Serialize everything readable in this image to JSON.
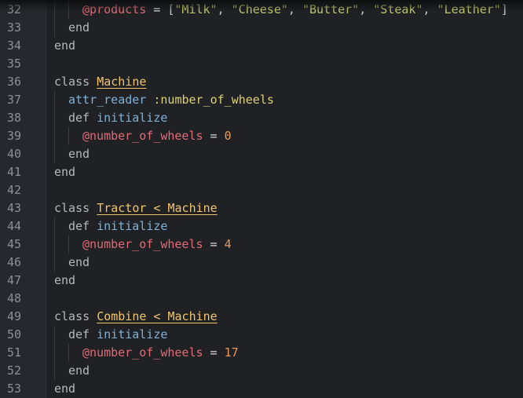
{
  "lines": [
    {
      "n": "32",
      "indent": 2,
      "tokens": [
        {
          "c": "ivar",
          "t": "@products"
        },
        {
          "c": "op",
          "t": " = "
        },
        {
          "c": "punc",
          "t": "["
        },
        {
          "c": "str",
          "t": "\"Milk\""
        },
        {
          "c": "punc",
          "t": ", "
        },
        {
          "c": "str",
          "t": "\"Cheese\""
        },
        {
          "c": "punc",
          "t": ", "
        },
        {
          "c": "str",
          "t": "\"Butter\""
        },
        {
          "c": "punc",
          "t": ", "
        },
        {
          "c": "str",
          "t": "\"Steak\""
        },
        {
          "c": "punc",
          "t": ", "
        },
        {
          "c": "str",
          "t": "\"Leather\""
        },
        {
          "c": "punc",
          "t": "]"
        }
      ]
    },
    {
      "n": "33",
      "indent": 1,
      "tokens": [
        {
          "c": "kw",
          "t": "end"
        }
      ]
    },
    {
      "n": "34",
      "indent": 0,
      "tokens": [
        {
          "c": "kw",
          "t": "end"
        }
      ]
    },
    {
      "n": "35",
      "indent": 0,
      "tokens": []
    },
    {
      "n": "36",
      "indent": 0,
      "tokens": [
        {
          "c": "kw",
          "t": "class "
        },
        {
          "c": "cls",
          "t": "Machine"
        }
      ]
    },
    {
      "n": "37",
      "indent": 1,
      "tokens": [
        {
          "c": "meth",
          "t": "attr_reader "
        },
        {
          "c": "sym",
          "t": ":number_of_wheels"
        }
      ]
    },
    {
      "n": "38",
      "indent": 1,
      "tokens": [
        {
          "c": "kw",
          "t": "def "
        },
        {
          "c": "meth",
          "t": "initialize"
        }
      ]
    },
    {
      "n": "39",
      "indent": 2,
      "tokens": [
        {
          "c": "ivar",
          "t": "@number_of_wheels"
        },
        {
          "c": "op",
          "t": " = "
        },
        {
          "c": "num",
          "t": "0"
        }
      ]
    },
    {
      "n": "40",
      "indent": 1,
      "tokens": [
        {
          "c": "kw",
          "t": "end"
        }
      ]
    },
    {
      "n": "41",
      "indent": 0,
      "tokens": [
        {
          "c": "kw",
          "t": "end"
        }
      ]
    },
    {
      "n": "42",
      "indent": 0,
      "tokens": []
    },
    {
      "n": "43",
      "indent": 0,
      "tokens": [
        {
          "c": "kw",
          "t": "class "
        },
        {
          "c": "cls",
          "t": "Tractor < Machine"
        }
      ]
    },
    {
      "n": "44",
      "indent": 1,
      "tokens": [
        {
          "c": "kw",
          "t": "def "
        },
        {
          "c": "meth",
          "t": "initialize"
        }
      ]
    },
    {
      "n": "45",
      "indent": 2,
      "tokens": [
        {
          "c": "ivar",
          "t": "@number_of_wheels"
        },
        {
          "c": "op",
          "t": " = "
        },
        {
          "c": "num",
          "t": "4"
        }
      ]
    },
    {
      "n": "46",
      "indent": 1,
      "tokens": [
        {
          "c": "kw",
          "t": "end"
        }
      ]
    },
    {
      "n": "47",
      "indent": 0,
      "tokens": [
        {
          "c": "kw",
          "t": "end"
        }
      ]
    },
    {
      "n": "48",
      "indent": 0,
      "tokens": []
    },
    {
      "n": "49",
      "indent": 0,
      "tokens": [
        {
          "c": "kw",
          "t": "class "
        },
        {
          "c": "cls",
          "t": "Combine < Machine"
        }
      ]
    },
    {
      "n": "50",
      "indent": 1,
      "tokens": [
        {
          "c": "kw",
          "t": "def "
        },
        {
          "c": "meth",
          "t": "initialize"
        }
      ]
    },
    {
      "n": "51",
      "indent": 2,
      "tokens": [
        {
          "c": "ivar",
          "t": "@number_of_wheels"
        },
        {
          "c": "op",
          "t": " = "
        },
        {
          "c": "num",
          "t": "17"
        }
      ]
    },
    {
      "n": "52",
      "indent": 1,
      "tokens": [
        {
          "c": "kw",
          "t": "end"
        }
      ]
    },
    {
      "n": "53",
      "indent": 0,
      "tokens": [
        {
          "c": "kw",
          "t": "end"
        }
      ]
    }
  ],
  "theme": {
    "background": "#1f2124",
    "gutter": "#25282c",
    "keyword": "#b6b8bb",
    "method": "#7fb1d8",
    "instance_variable": "#e06c75",
    "number": "#e89a5a",
    "class_name": "#f2c56b",
    "symbol": "#dcd07a",
    "string": "#c3c870"
  }
}
